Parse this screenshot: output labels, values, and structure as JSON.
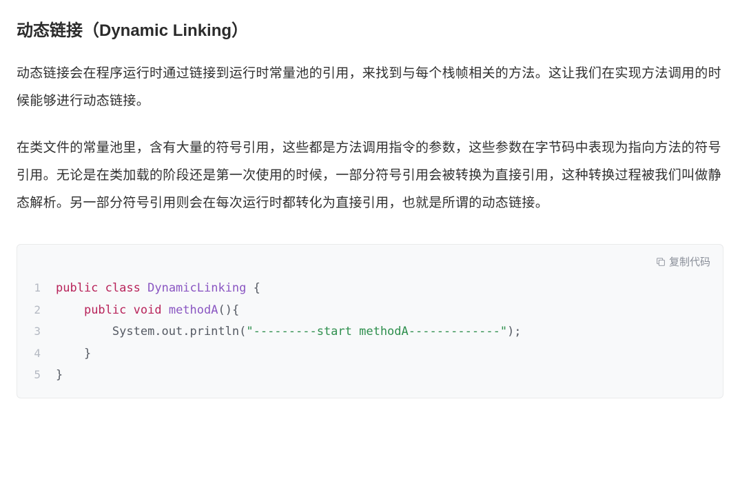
{
  "heading": "动态链接（Dynamic Linking）",
  "paragraph1": "动态链接会在程序运行时通过链接到运行时常量池的引用，来找到与每个栈帧相关的方法。这让我们在实现方法调用的时候能够进行动态链接。",
  "paragraph2": "在类文件的常量池里，含有大量的符号引用，这些都是方法调用指令的参数，这些参数在字节码中表现为指向方法的符号引用。无论是在类加载的阶段还是第一次使用的时候，一部分符号引用会被转换为直接引用，这种转换过程被我们叫做静态解析。另一部分符号引用则会在每次运行时都转化为直接引用，也就是所谓的动态链接。",
  "copy_label": "复制代码",
  "code": {
    "line1": {
      "kw1": "public",
      "kw2": "class",
      "cls": "DynamicLinking",
      "rest": " {"
    },
    "line2": {
      "indent": "    ",
      "kw1": "public",
      "kw2": "void",
      "cls": "methodA",
      "rest": "(){"
    },
    "line3": {
      "indent": "        ",
      "call": "System.out.println(",
      "str": "\"---------start methodA-------------\"",
      "rest": ");"
    },
    "line4": {
      "text": "    }"
    },
    "line5": {
      "text": "}"
    }
  },
  "ln": {
    "l1": "1",
    "l2": "2",
    "l3": "3",
    "l4": "4",
    "l5": "5"
  }
}
